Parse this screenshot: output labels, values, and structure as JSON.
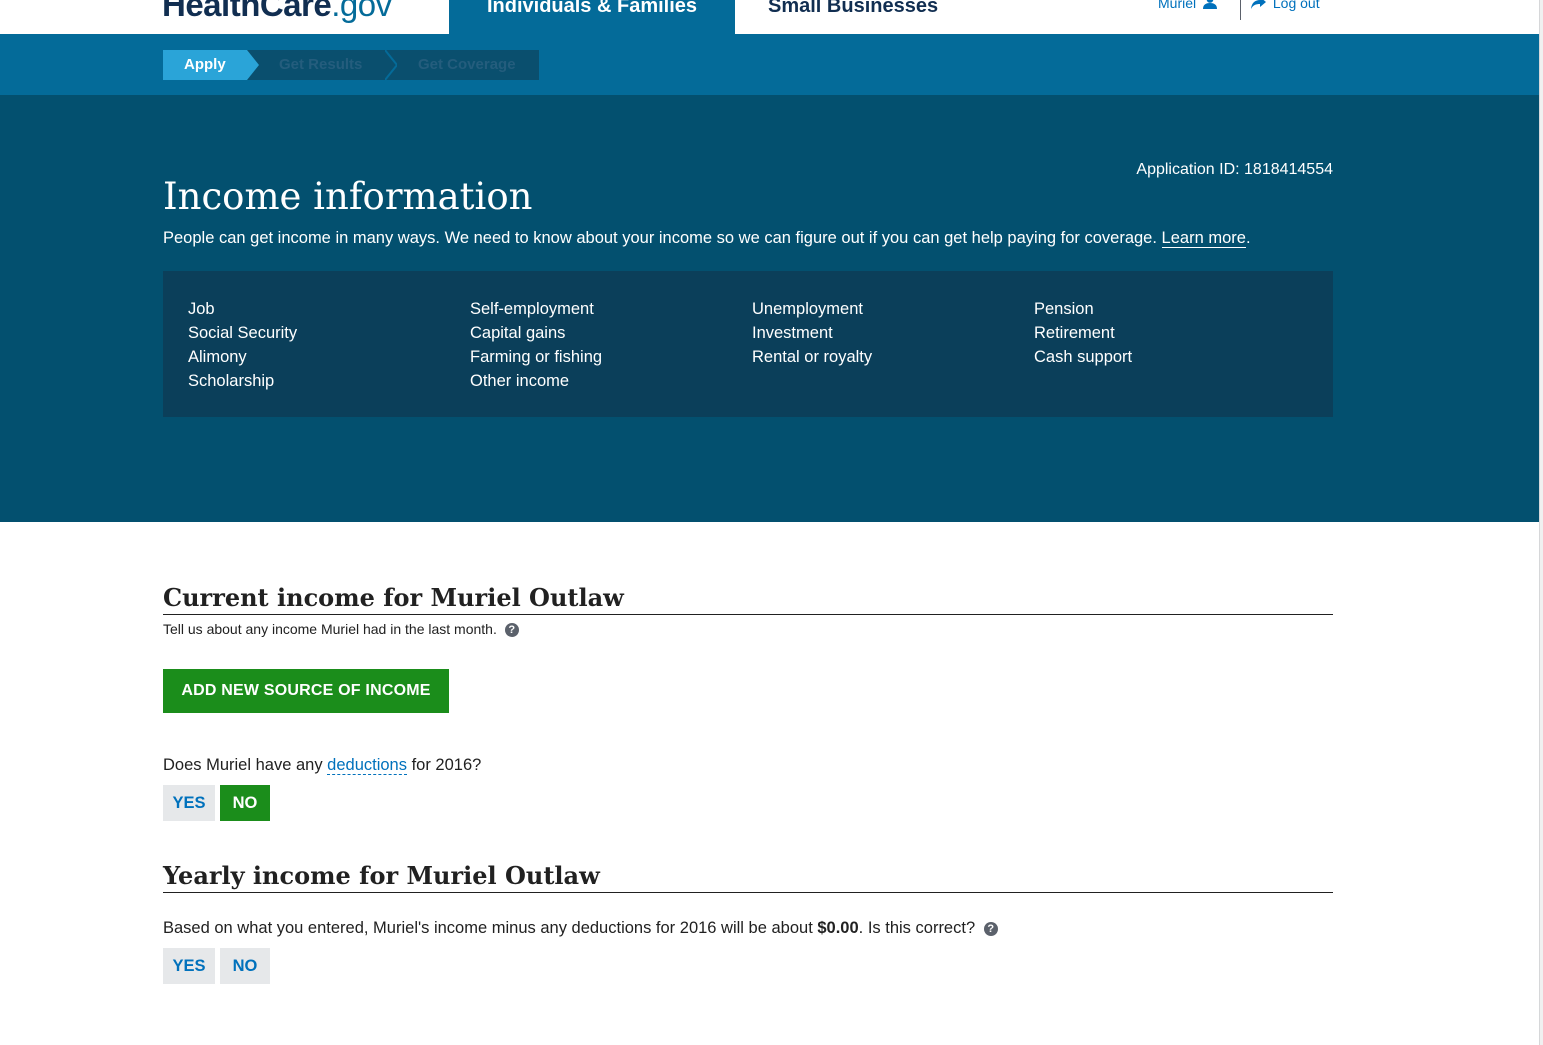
{
  "header": {
    "logo_main": "HealthCare",
    "logo_suffix": ".gov",
    "nav_tabs": [
      {
        "label": "Individuals & Families"
      },
      {
        "label": "Small Businesses"
      }
    ],
    "user_name": "Muriel",
    "logout_label": "Log out",
    "icons": {
      "user": "user-icon",
      "logout": "share-arrow-icon"
    }
  },
  "steps": {
    "items": [
      {
        "label": "Apply",
        "state": "current"
      },
      {
        "label": "Get Results",
        "state": "upcoming"
      },
      {
        "label": "Get Coverage",
        "state": "upcoming"
      }
    ]
  },
  "hero": {
    "application_id": "Application ID: 1818414554",
    "title": "Income information",
    "intro_text": "People can get income in many ways. We need to know about your income so we can figure out if you can get help paying for coverage.",
    "learn_more": "Learn more",
    "intro_end": ".",
    "income_types": [
      [
        "Job",
        "Social Security",
        "Alimony",
        "Scholarship"
      ],
      [
        "Self-employment",
        "Capital gains",
        "Farming or fishing",
        "Other income"
      ],
      [
        "Unemployment",
        "Investment",
        "Rental or royalty"
      ],
      [
        "Pension",
        "Retirement",
        "Cash support"
      ]
    ]
  },
  "current_income": {
    "title": "Current income for Muriel Outlaw",
    "subtitle": "Tell us about any income Muriel had in the last month.",
    "add_button": "ADD NEW SOURCE OF INCOME",
    "deductions_question_pre": "Does Muriel have any",
    "deductions_term": "deductions",
    "deductions_question_post": "for 2016?",
    "yes_label": "YES",
    "no_label": "NO",
    "selected": "NO"
  },
  "yearly_income": {
    "title": "Yearly income for Muriel Outlaw",
    "question_pre": "Based on what you entered, Muriel's income minus any deductions for 2016 will be about",
    "amount": "$0.00",
    "question_post": ". Is this correct?",
    "yes_label": "YES",
    "no_label": "NO",
    "selected": ""
  },
  "colors": {
    "brand_dark": "#112e51",
    "header_blue": "#046b99",
    "hero_bg": "#03506f",
    "types_box_bg": "#0b3f5a",
    "step_active": "#2aa4d8",
    "green": "#1b8d1b",
    "link": "#0071bc",
    "button_off": "#e6e8ea"
  }
}
